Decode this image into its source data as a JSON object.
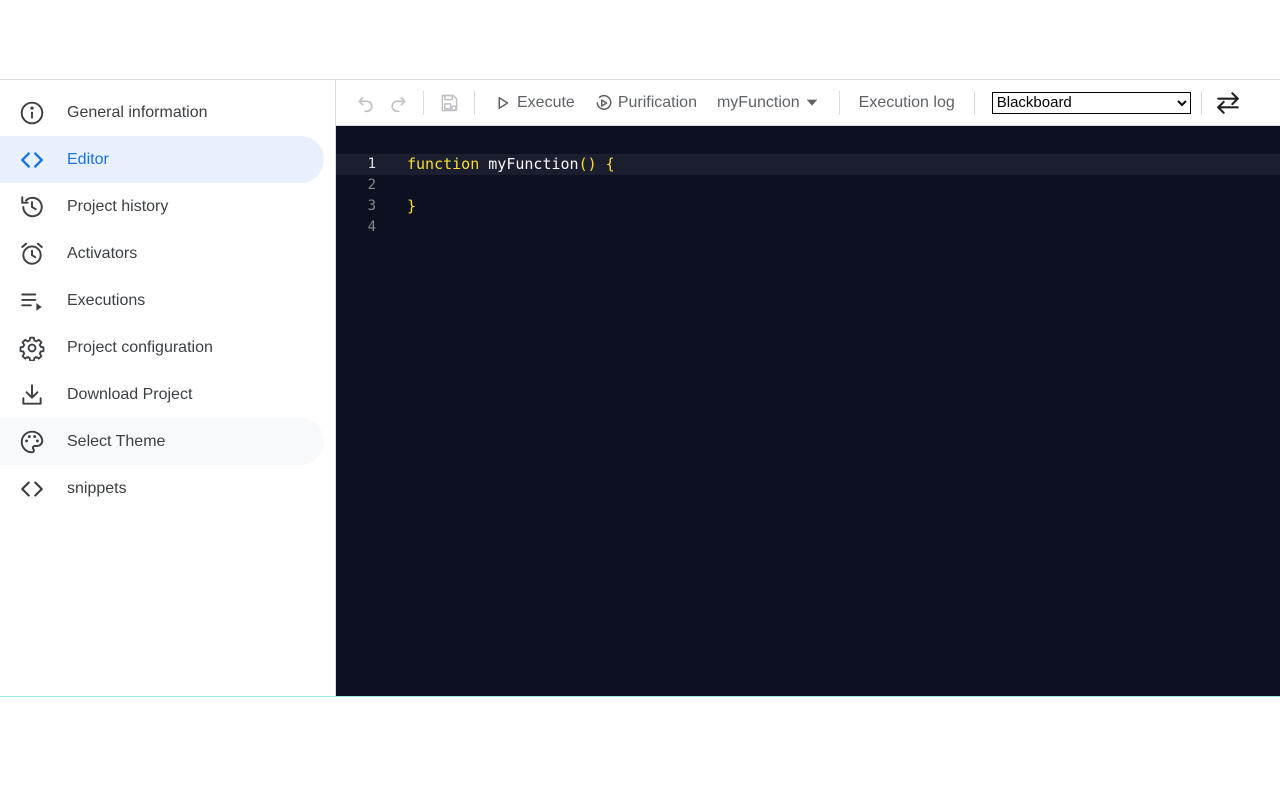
{
  "sidebar": {
    "items": [
      {
        "label": "General information",
        "icon": "info-icon"
      },
      {
        "label": "Editor",
        "icon": "code-icon"
      },
      {
        "label": "Project history",
        "icon": "history-icon"
      },
      {
        "label": "Activators",
        "icon": "alarm-icon"
      },
      {
        "label": "Executions",
        "icon": "executions-list-icon"
      },
      {
        "label": "Project configuration",
        "icon": "gear-icon"
      },
      {
        "label": "Download Project",
        "icon": "download-icon"
      },
      {
        "label": "Select Theme",
        "icon": "palette-icon"
      },
      {
        "label": "snippets",
        "icon": "code-icon"
      }
    ],
    "active_index": 1,
    "hover_index": 7
  },
  "toolbar": {
    "execute_label": "Execute",
    "purification_label": "Purification",
    "function_label": "myFunction",
    "execution_log_label": "Execution log",
    "theme_select": {
      "selected": "Blackboard",
      "options": [
        "Blackboard"
      ]
    }
  },
  "editor": {
    "lines": [
      {
        "number": "1",
        "keyword": "function",
        "text": " myFunction",
        "punct": "() {"
      },
      {
        "number": "2",
        "keyword": "",
        "text": "",
        "punct": ""
      },
      {
        "number": "3",
        "keyword": "",
        "text": "",
        "punct": "}"
      },
      {
        "number": "4",
        "keyword": "",
        "text": "",
        "punct": ""
      }
    ]
  },
  "colors": {
    "accent": "#1a73e8",
    "active_bg": "#e8f0fe",
    "editor_bg": "#0c1021",
    "keyword": "#fbde2d"
  }
}
